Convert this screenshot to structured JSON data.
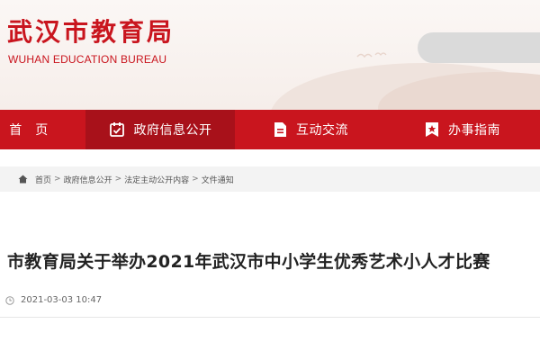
{
  "header": {
    "title": "武汉市教育局",
    "subtitle": "WUHAN EDUCATION BUREAU"
  },
  "nav": {
    "items": [
      {
        "label": "首　页",
        "icon": "home-icon"
      },
      {
        "label": "政府信息公开",
        "icon": "checklist-icon",
        "active": true
      },
      {
        "label": "互动交流",
        "icon": "document-icon"
      },
      {
        "label": "办事指南",
        "icon": "star-flag-icon"
      }
    ]
  },
  "breadcrumb": {
    "items": [
      "首页",
      "政府信息公开",
      "法定主动公开内容",
      "文件通知"
    ],
    "separator": ">"
  },
  "article": {
    "title": "市教育局关于举办2021年武汉市中小学生优秀艺术小人才比赛",
    "datetime": "2021-03-03 10:47"
  },
  "colors": {
    "brand_red": "#c9151e",
    "nav_active": "#a8111a",
    "breadcrumb_bg": "#f3f3f3"
  }
}
